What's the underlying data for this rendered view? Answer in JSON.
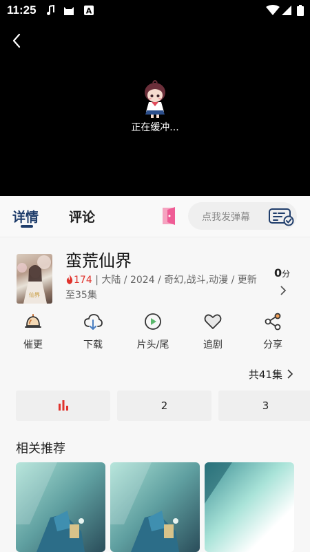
{
  "status_bar": {
    "time": "11:25",
    "icons": [
      "music-note-icon",
      "cat-app-icon",
      "font-a-icon",
      "wifi-icon",
      "signal-icon",
      "battery-icon"
    ]
  },
  "player": {
    "buffering_text": "正在缓冲...",
    "background_color": "#000000"
  },
  "tabs": [
    {
      "label": "详情",
      "active": true
    },
    {
      "label": "评论",
      "active": false
    }
  ],
  "danmu": {
    "placeholder": "点我发弹幕"
  },
  "show": {
    "title": "蛮荒仙界",
    "heat": "174",
    "meta": "| 大陆 / 2024 / 奇幻,战斗,动漫 / 更新至35集",
    "score_value": "0",
    "score_unit": "分"
  },
  "actions": [
    {
      "label": "催更",
      "icon": "bell-icon"
    },
    {
      "label": "下载",
      "icon": "cloud-download-icon"
    },
    {
      "label": "片头/尾",
      "icon": "play-circle-icon"
    },
    {
      "label": "追剧",
      "icon": "heart-icon"
    },
    {
      "label": "分享",
      "icon": "share-icon"
    }
  ],
  "episodes": {
    "total_label": "共41集",
    "items": [
      {
        "label": "",
        "playing": true
      },
      {
        "label": "2",
        "playing": false
      },
      {
        "label": "3",
        "playing": false
      }
    ]
  },
  "recommend": {
    "title": "相关推荐"
  },
  "colors": {
    "accent_dark_blue": "#1f3d6b",
    "hot_red": "#e0332d",
    "exit_pink": "#ef5c95"
  }
}
